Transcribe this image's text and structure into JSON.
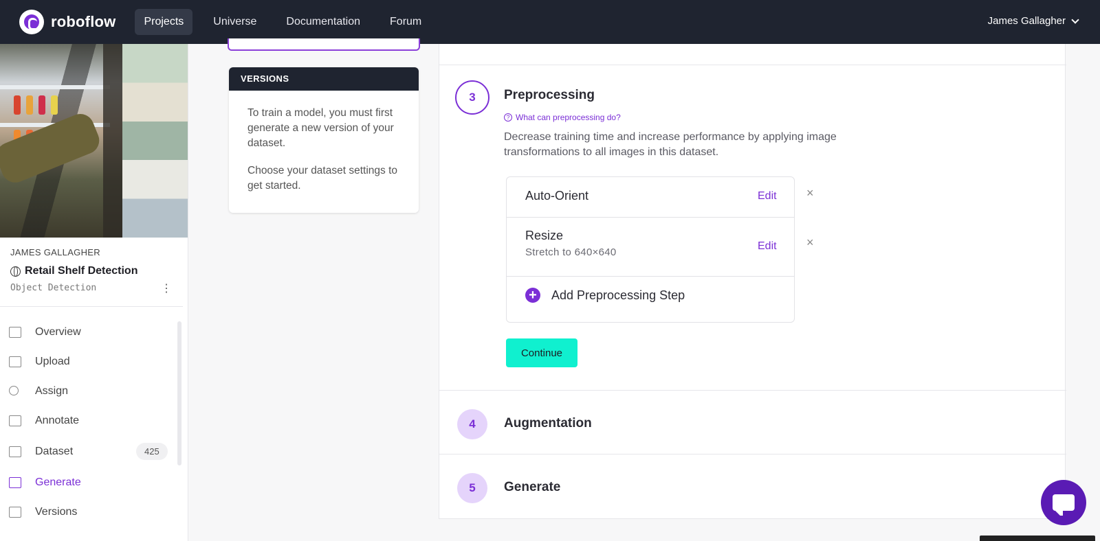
{
  "topbar": {
    "brand": "roboflow",
    "nav": [
      {
        "label": "Projects",
        "active": true
      },
      {
        "label": "Universe",
        "active": false
      },
      {
        "label": "Documentation",
        "active": false
      },
      {
        "label": "Forum",
        "active": false
      }
    ],
    "user": "James Gallagher",
    "icons": {
      "logo": "roboflow-logo-icon",
      "user_menu": "chevron-down-icon"
    }
  },
  "sidebar": {
    "owner": "JAMES GALLAGHER",
    "project_name": "Retail Shelf Detection",
    "project_type": "Object Detection",
    "menu": [
      {
        "label": "Overview",
        "icon": "book-icon",
        "active": false
      },
      {
        "label": "Upload",
        "icon": "upload-icon",
        "active": false
      },
      {
        "label": "Assign",
        "icon": "search-icon",
        "active": false
      },
      {
        "label": "Annotate",
        "icon": "annotate-icon",
        "active": false
      },
      {
        "label": "Dataset",
        "icon": "images-icon",
        "active": false,
        "badge": "425"
      },
      {
        "label": "Generate",
        "icon": "generate-icon",
        "active": true
      },
      {
        "label": "Versions",
        "icon": "folder-icon",
        "active": false
      }
    ]
  },
  "versions_panel": {
    "title": "VERSIONS",
    "text1": "To train a model, you must first generate a new version of your dataset.",
    "text2": "Choose your dataset settings to get started."
  },
  "steps": {
    "preprocessing": {
      "number": "3",
      "title": "Preprocessing",
      "help": "What can preprocessing do?",
      "description": "Decrease training time and increase performance by applying image transformations to all images in this dataset.",
      "items": [
        {
          "name": "Auto-Orient",
          "detail": "",
          "edit": "Edit",
          "remove": "×"
        },
        {
          "name": "Resize",
          "detail": "Stretch to 640×640",
          "edit": "Edit",
          "remove": "×"
        }
      ],
      "add_step": "Add Preprocessing Step",
      "continue": "Continue"
    },
    "augmentation": {
      "number": "4",
      "title": "Augmentation"
    },
    "generate": {
      "number": "5",
      "title": "Generate"
    }
  },
  "colors": {
    "accent": "#7b2fd6",
    "nav_bg": "#1f2430",
    "continue_bg": "#10f0cf",
    "step_todo_bg": "#e5d4fb"
  }
}
